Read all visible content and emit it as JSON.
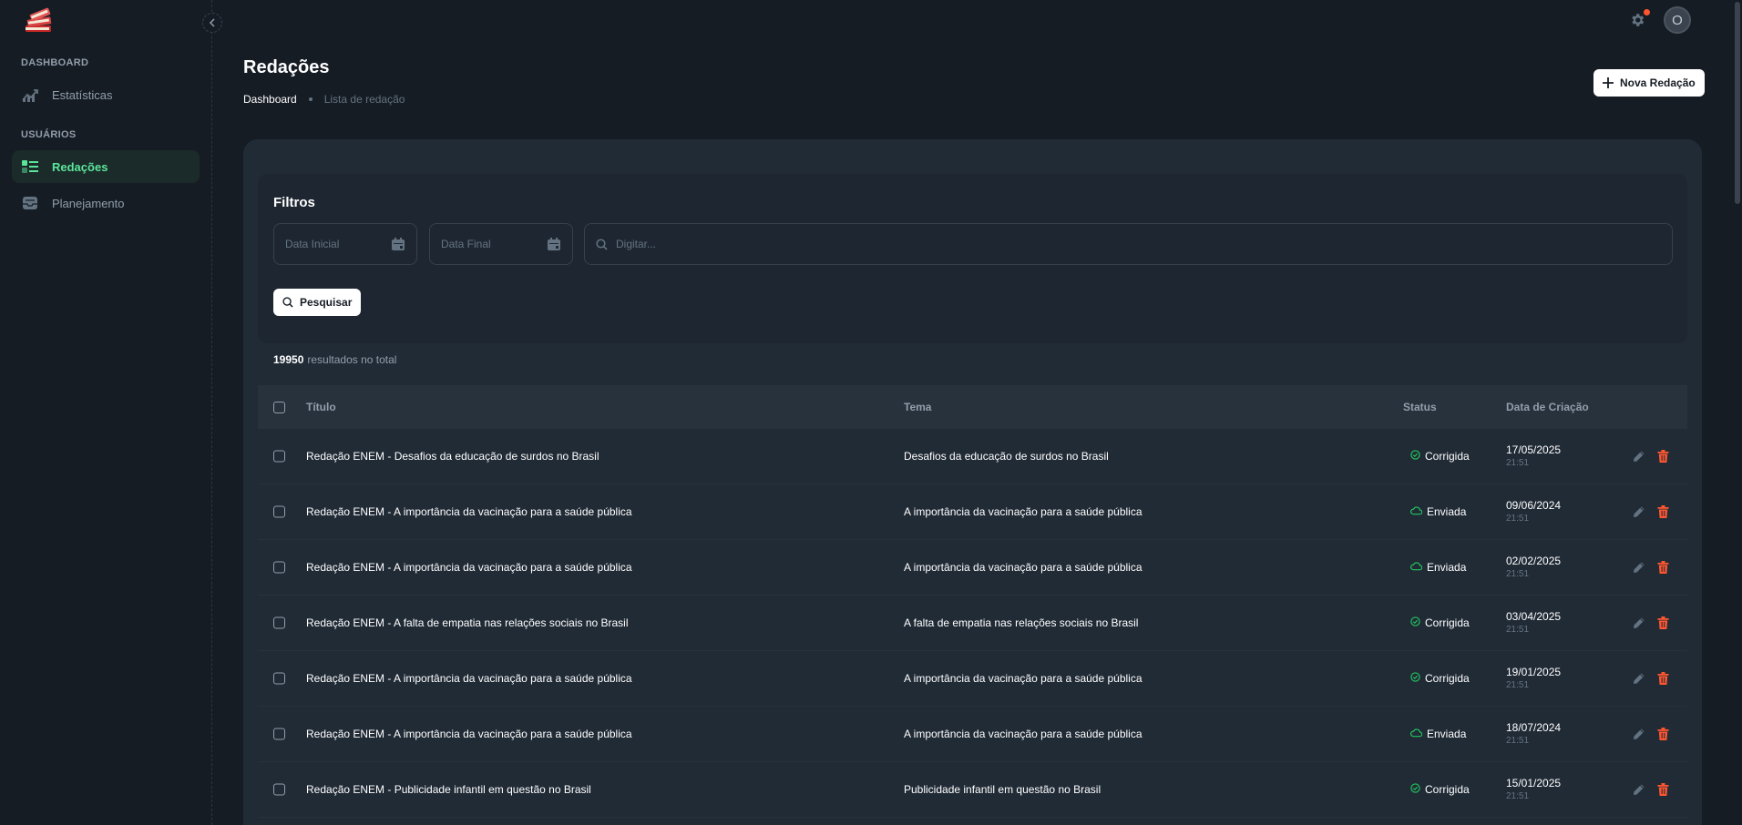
{
  "sidebar": {
    "sections": [
      {
        "title": "DASHBOARD",
        "items": [
          {
            "label": "Estatísticas",
            "icon": "chart-icon",
            "active": false
          }
        ]
      },
      {
        "title": "USUÁRIOS",
        "items": [
          {
            "label": "Redações",
            "icon": "list-icon",
            "active": true
          },
          {
            "label": "Planejamento",
            "icon": "tray-icon",
            "active": false
          }
        ]
      }
    ]
  },
  "topbar": {
    "avatar_initial": "O"
  },
  "header": {
    "title": "Redações",
    "breadcrumb": [
      "Dashboard",
      "Lista de redação"
    ],
    "new_button": "Nova Redação"
  },
  "filters": {
    "title": "Filtros",
    "start_date_placeholder": "Data Inicial",
    "end_date_placeholder": "Data Final",
    "search_placeholder": "Digitar...",
    "search_button": "Pesquisar"
  },
  "results": {
    "count": "19950",
    "label": "resultados no total"
  },
  "table": {
    "headers": {
      "title": "Título",
      "theme": "Tema",
      "status": "Status",
      "created": "Data de Criação"
    },
    "rows": [
      {
        "title": "Redação ENEM - Desafios da educação de surdos no Brasil",
        "theme": "Desafios da educação de surdos no Brasil",
        "status": "Corrigida",
        "date": "17/05/2025",
        "time": "21:51"
      },
      {
        "title": "Redação ENEM - A importância da vacinação para a saúde pública",
        "theme": "A importância da vacinação para a saúde pública",
        "status": "Enviada",
        "date": "09/06/2024",
        "time": "21:51"
      },
      {
        "title": "Redação ENEM - A importância da vacinação para a saúde pública",
        "theme": "A importância da vacinação para a saúde pública",
        "status": "Enviada",
        "date": "02/02/2025",
        "time": "21:51"
      },
      {
        "title": "Redação ENEM - A falta de empatia nas relações sociais no Brasil",
        "theme": "A falta de empatia nas relações sociais no Brasil",
        "status": "Corrigida",
        "date": "03/04/2025",
        "time": "21:51"
      },
      {
        "title": "Redação ENEM - A importância da vacinação para a saúde pública",
        "theme": "A importância da vacinação para a saúde pública",
        "status": "Corrigida",
        "date": "19/01/2025",
        "time": "21:51"
      },
      {
        "title": "Redação ENEM - A importância da vacinação para a saúde pública",
        "theme": "A importância da vacinação para a saúde pública",
        "status": "Enviada",
        "date": "18/07/2024",
        "time": "21:51"
      },
      {
        "title": "Redação ENEM - Publicidade infantil em questão no Brasil",
        "theme": "Publicidade infantil em questão no Brasil",
        "status": "Corrigida",
        "date": "15/01/2025",
        "time": "21:51"
      }
    ]
  },
  "colors": {
    "accent": "#5be49b",
    "status_ok": "#22c55e",
    "delete": "#ff5630",
    "bg": "#161c24",
    "card": "#212b36"
  }
}
